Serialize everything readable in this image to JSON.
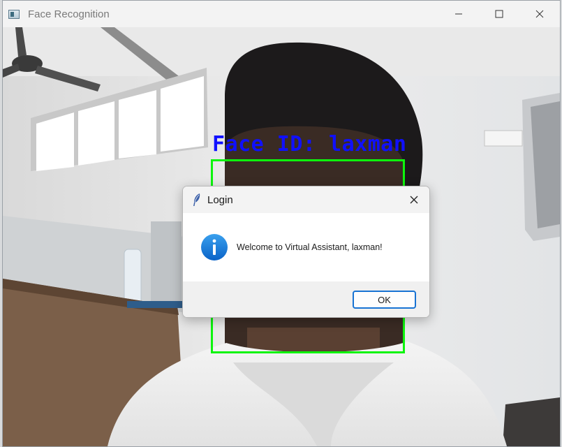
{
  "window": {
    "title": "Face Recognition",
    "controls": {
      "minimize": "minimize-icon",
      "maximize": "maximize-icon",
      "close": "close-icon"
    }
  },
  "overlay": {
    "face_label": "Face ID: laxman",
    "label_color": "#1010ff",
    "box_color": "#0df50d"
  },
  "dialog": {
    "title": "Login",
    "message": "Welcome to Virtual Assistant, laxman!",
    "ok_label": "OK",
    "icon": "info-icon",
    "accent": "#1873d3"
  }
}
